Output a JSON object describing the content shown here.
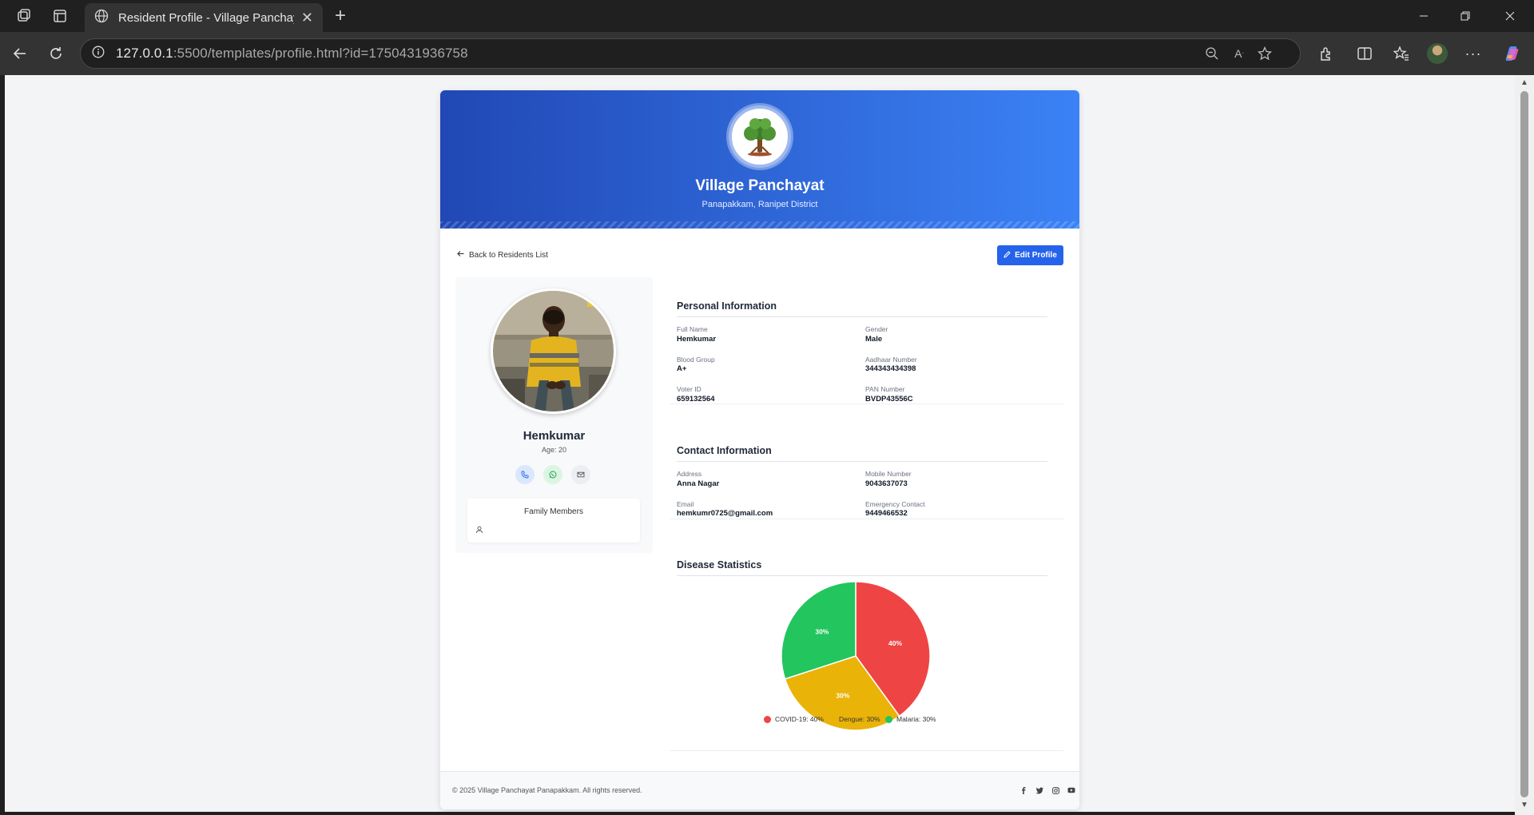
{
  "browser": {
    "tab_title": "Resident Profile - Village Panchayat",
    "url_host": "127.0.0.1",
    "url_rest": ":5500/templates/profile.html?id=1750431936758"
  },
  "header": {
    "title": "Village Panchayat",
    "subtitle": "Panapakkam, Ranipet District"
  },
  "actions": {
    "back_label": "Back to Residents List",
    "edit_label": "Edit Profile"
  },
  "resident": {
    "name": "Hemkumar",
    "age": "Age: 20",
    "family_title": "Family Members"
  },
  "personal": {
    "title": "Personal Information",
    "full_name_label": "Full Name",
    "full_name": "Hemkumar",
    "gender_label": "Gender",
    "gender": "Male",
    "blood_label": "Blood Group",
    "blood": "A+",
    "aadhaar_label": "Aadhaar Number",
    "aadhaar": "344343434398",
    "voter_label": "Voter ID",
    "voter": "659132564",
    "pan_label": "PAN Number",
    "pan": "BVDP43556C"
  },
  "contact": {
    "title": "Contact Information",
    "address_label": "Address",
    "address": "Anna Nagar",
    "mobile_label": "Mobile Number",
    "mobile": "9043637073",
    "email_label": "Email",
    "email": "hemkumr0725@gmail.com",
    "emergency_label": "Emergency Contact",
    "emergency": "9449466532"
  },
  "disease": {
    "title": "Disease Statistics"
  },
  "chart_data": {
    "type": "pie",
    "categories": [
      "COVID-19",
      "Dengue",
      "Malaria"
    ],
    "values": [
      40,
      30,
      30
    ],
    "slice_labels": [
      "40%",
      "30%",
      "30%"
    ],
    "legend_labels": [
      "COVID-19: 40%",
      "Dengue: 30%",
      "Malaria: 30%"
    ],
    "colors": [
      "#ef4444",
      "#eab308",
      "#22c55e"
    ],
    "legend_position": "bottom"
  },
  "footer": {
    "copyright": "© 2025 Village Panchayat Panapakkam. All rights reserved."
  },
  "colors": {
    "primary": "#2563eb",
    "hero_start": "#2148b5",
    "hero_end": "#3b82f6"
  }
}
